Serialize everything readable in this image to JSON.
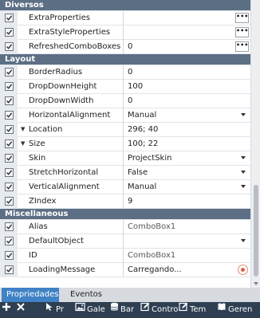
{
  "categories": [
    {
      "title": "Diversos",
      "rows": [
        {
          "name": "ExtraProperties",
          "value": "",
          "editor": "dots"
        },
        {
          "name": "ExtraStyleProperties",
          "value": "",
          "editor": "dots"
        },
        {
          "name": "RefreshedComboBoxes",
          "value": "0",
          "editor": "dots"
        }
      ]
    },
    {
      "title": "Layout",
      "rows": [
        {
          "name": "BorderRadius",
          "value": "0"
        },
        {
          "name": "DropDownHeight",
          "value": "100"
        },
        {
          "name": "DropDownWidth",
          "value": "0"
        },
        {
          "name": "HorizontalAlignment",
          "value": "Manual",
          "editor": "dropdown"
        },
        {
          "name": "Location",
          "value": "296; 40",
          "expandable": true
        },
        {
          "name": "Size",
          "value": "100; 22",
          "expandable": true
        },
        {
          "name": "Skin",
          "value": "ProjectSkin",
          "editor": "dropdown"
        },
        {
          "name": "StretchHorizontal",
          "value": "False",
          "editor": "dropdown"
        },
        {
          "name": "VerticalAlignment",
          "value": "Manual",
          "editor": "dropdown"
        },
        {
          "name": "ZIndex",
          "value": "9"
        }
      ]
    },
    {
      "title": "Miscellaneous",
      "rows": [
        {
          "name": "Alias",
          "value": "ComboBox1",
          "dim": true
        },
        {
          "name": "DefaultObject",
          "value": "",
          "editor": "dropdown"
        },
        {
          "name": "ID",
          "value": "ComboBox1",
          "dim": true
        },
        {
          "name": "LoadingMessage",
          "value": "Carregando...",
          "editor": "info"
        }
      ]
    }
  ],
  "tabs": [
    {
      "label": "Propriedades",
      "active": true
    },
    {
      "label": "Eventos",
      "active": false
    }
  ],
  "toolbar": [
    {
      "label": "",
      "icon": "plus-icon"
    },
    {
      "label": "",
      "icon": "pin-icon"
    },
    {
      "label": "Pr",
      "icon": "cursor-icon"
    },
    {
      "label": "Gale",
      "icon": "image-icon"
    },
    {
      "label": "Bar",
      "icon": "database-icon"
    },
    {
      "label": "Contro",
      "icon": "edit-icon"
    },
    {
      "label": "Tem",
      "icon": "edit-icon"
    },
    {
      "label": "Geren",
      "icon": "book-icon"
    }
  ]
}
